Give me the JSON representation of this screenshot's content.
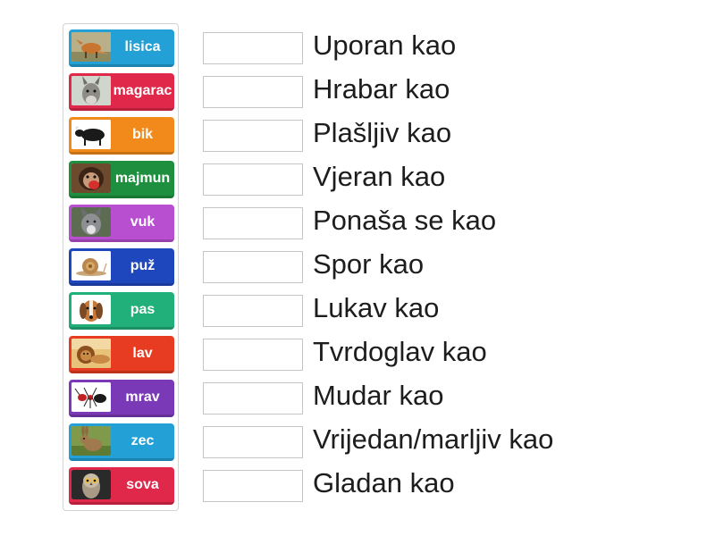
{
  "tiles": [
    {
      "label": "lisica",
      "color": "#23a0d6",
      "picture": "fox-photo"
    },
    {
      "label": "magarac",
      "color": "#e0284a",
      "picture": "donkey-photo"
    },
    {
      "label": "bik",
      "color": "#f28a1b",
      "picture": "bull-photo"
    },
    {
      "label": "majmun",
      "color": "#1e8f3e",
      "picture": "monkey-photo"
    },
    {
      "label": "vuk",
      "color": "#b84fd0",
      "picture": "wolf-photo"
    },
    {
      "label": "puž",
      "color": "#1f47bd",
      "picture": "snail-photo"
    },
    {
      "label": "pas",
      "color": "#22b07a",
      "picture": "dog-photo"
    },
    {
      "label": "lav",
      "color": "#e83c22",
      "picture": "lion-photo"
    },
    {
      "label": "mrav",
      "color": "#7a3ab8",
      "picture": "ant-photo"
    },
    {
      "label": "zec",
      "color": "#23a0d6",
      "picture": "rabbit-photo"
    },
    {
      "label": "sova",
      "color": "#e0284a",
      "picture": "owl-photo"
    }
  ],
  "phrases": [
    "Uporan kao",
    "Hrabar kao",
    "Plašljiv kao",
    "Vjeran kao",
    "Ponaša se kao",
    "Spor kao",
    "Lukav kao",
    "Tvrdoglav kao",
    "Mudar kao",
    "Vrijedan/marljiv kao",
    "Gladan kao"
  ]
}
